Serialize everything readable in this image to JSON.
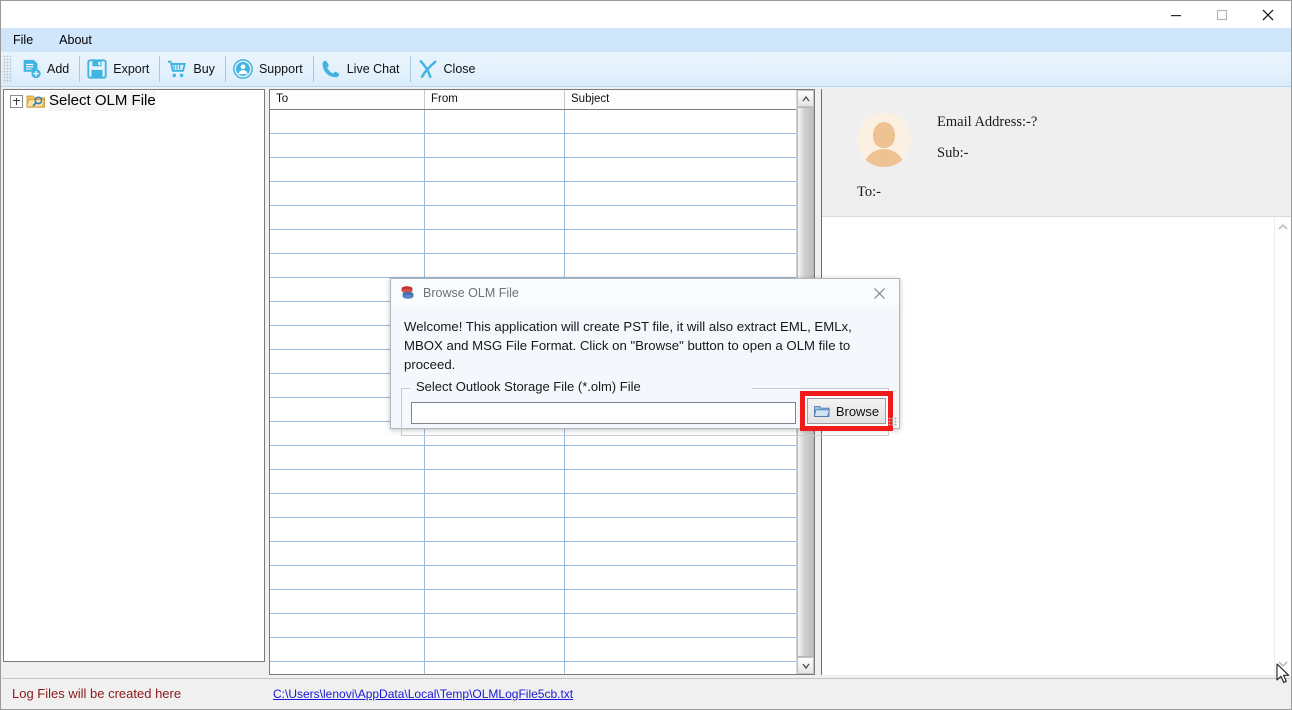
{
  "window": {
    "controls": [
      {
        "name": "minimize",
        "glyph": "—"
      },
      {
        "name": "maximize",
        "glyph": "▢"
      },
      {
        "name": "close",
        "glyph": "✕"
      }
    ]
  },
  "menubar": {
    "items": [
      {
        "label": "File"
      },
      {
        "label": "About"
      }
    ]
  },
  "toolbar": {
    "buttons": [
      {
        "label": "Add",
        "icon": "add-document-icon"
      },
      {
        "label": "Export",
        "icon": "floppy-save-icon"
      },
      {
        "label": "Buy",
        "icon": "shopping-cart-icon"
      },
      {
        "label": "Support",
        "icon": "support-person-icon"
      },
      {
        "label": "Live Chat",
        "icon": "phone-icon"
      },
      {
        "label": "Close",
        "icon": "x-close-icon"
      }
    ]
  },
  "tree": {
    "root_label": "Select OLM File",
    "expander_state": "collapsed"
  },
  "grid": {
    "columns": [
      "To",
      "From",
      "Subject"
    ],
    "rows": [],
    "empty_row_count": 24
  },
  "preview": {
    "email_address": "Email Address:-?",
    "subject": "Sub:-",
    "to": "To:-"
  },
  "status": {
    "message": "Log Files will be created here",
    "log_path": "C:\\Users\\lenovi\\AppData\\Local\\Temp\\OLMLogFile5cb.txt"
  },
  "dialog": {
    "title": "Browse OLM File",
    "icon": "database-stack-icon",
    "close_glyph": "✕",
    "message": "Welcome! This application will create PST file, it will also extract EML, EMLx,  MBOX and MSG  File Format. Click on \"Browse\" button to open a OLM file to proceed.",
    "group_label": "Select Outlook Storage File (*.olm) File",
    "file_value": "",
    "file_placeholder": "",
    "browse_label": "Browse",
    "browse_icon": "folder-open-icon",
    "highlight_color": "#f01a1a"
  },
  "colors": {
    "menubar": "#cfe6fb",
    "toolbar_icon": "#3fb4e0",
    "status_text": "#8b1a1a",
    "link": "#1919d6",
    "highlight": "#f01a1a"
  }
}
